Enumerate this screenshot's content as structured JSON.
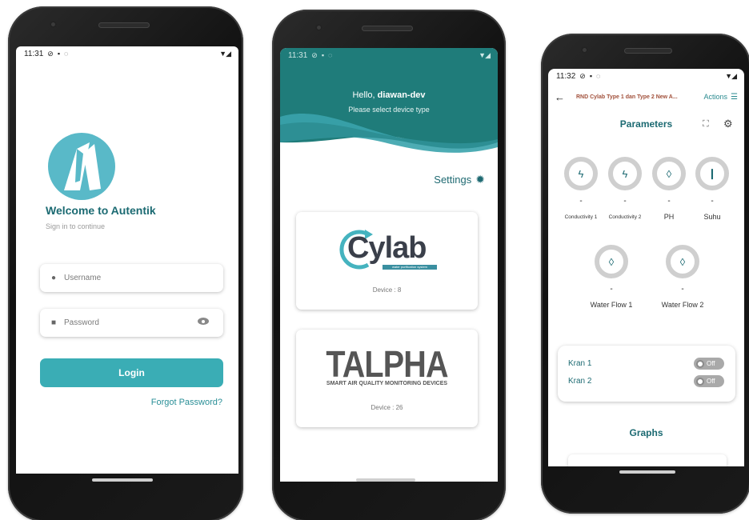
{
  "status": {
    "time_1": "11:31",
    "time_2": "11:31",
    "time_3": "11:32"
  },
  "login": {
    "welcome": "Welcome to Autentik",
    "subtitle": "Sign in to continue",
    "username_placeholder": "Username",
    "password_placeholder": "Password",
    "login_label": "Login",
    "forgot_label": "Forgot Password?"
  },
  "device_select": {
    "greeting": "Hello,",
    "username": "diawan-dev",
    "subtitle": "Please select device type",
    "settings_label": "Settings",
    "devices": [
      {
        "logo_text": "Cylab",
        "logo_sub": "water purification system",
        "count_label": "Device : 8"
      },
      {
        "logo_text": "TALPHA",
        "logo_sub": "SMART AIR QUALITY MONITORING DEVICES",
        "count_label": "Device : 26"
      }
    ]
  },
  "parameters": {
    "top_title": "RND Cylab Type 1 dan Type 2 New A...",
    "actions_label": "Actions",
    "title": "Parameters",
    "gauges": [
      {
        "value": "-",
        "label": "Conductivity 1",
        "icon": "bolt-icon"
      },
      {
        "value": "-",
        "label": "Conductivity 2",
        "icon": "bolt-icon"
      },
      {
        "value": "-",
        "label": "PH",
        "icon": "drop-icon"
      },
      {
        "value": "-",
        "label": "Suhu",
        "icon": "thermometer-icon"
      },
      {
        "value": "-",
        "label": "Water Flow 1",
        "icon": "drop-icon"
      },
      {
        "value": "-",
        "label": "Water Flow 2",
        "icon": "drop-icon"
      }
    ],
    "valves": [
      {
        "name": "Kran 1",
        "state": "Off"
      },
      {
        "name": "Kran 2",
        "state": "Off"
      }
    ],
    "graphs_title": "Graphs"
  },
  "colors": {
    "primary": "#3aadb5",
    "teal_dark": "#1c6a72",
    "header_teal": "#1f7c7a",
    "toggle_off": "#a9a9a9"
  }
}
